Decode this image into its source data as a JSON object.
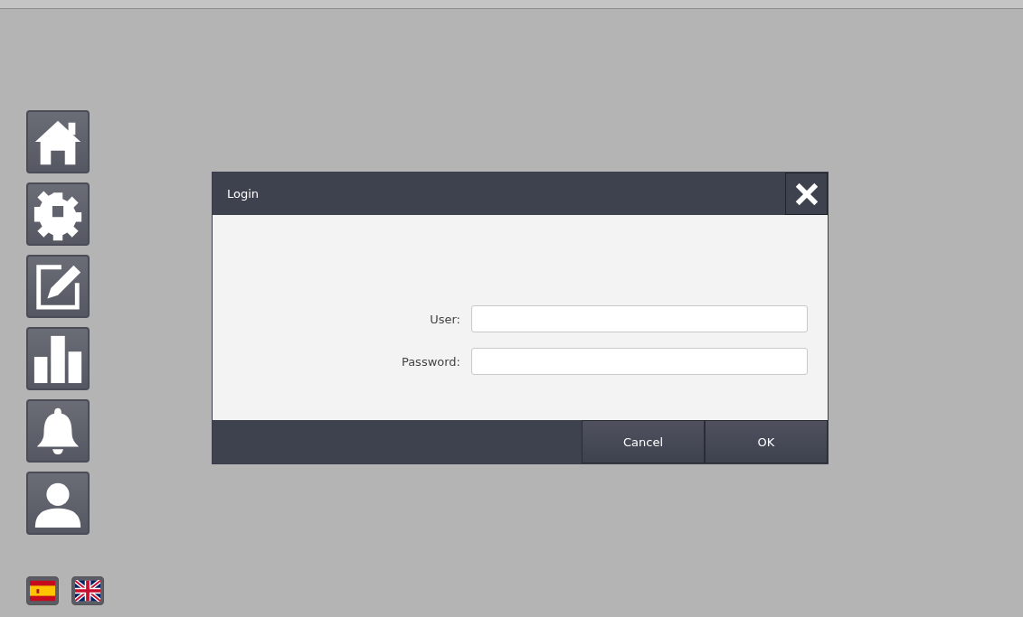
{
  "sidebar": {
    "items": [
      {
        "kind": "home"
      },
      {
        "kind": "settings"
      },
      {
        "kind": "edit"
      },
      {
        "kind": "chart"
      },
      {
        "kind": "bell"
      },
      {
        "kind": "user"
      }
    ]
  },
  "languages": [
    {
      "kind": "spain"
    },
    {
      "kind": "uk"
    }
  ],
  "dialog": {
    "title": "Login",
    "fields": [
      {
        "label": "User:"
      },
      {
        "label": "Password:"
      }
    ],
    "buttons": [
      "Cancel",
      "OK"
    ]
  }
}
